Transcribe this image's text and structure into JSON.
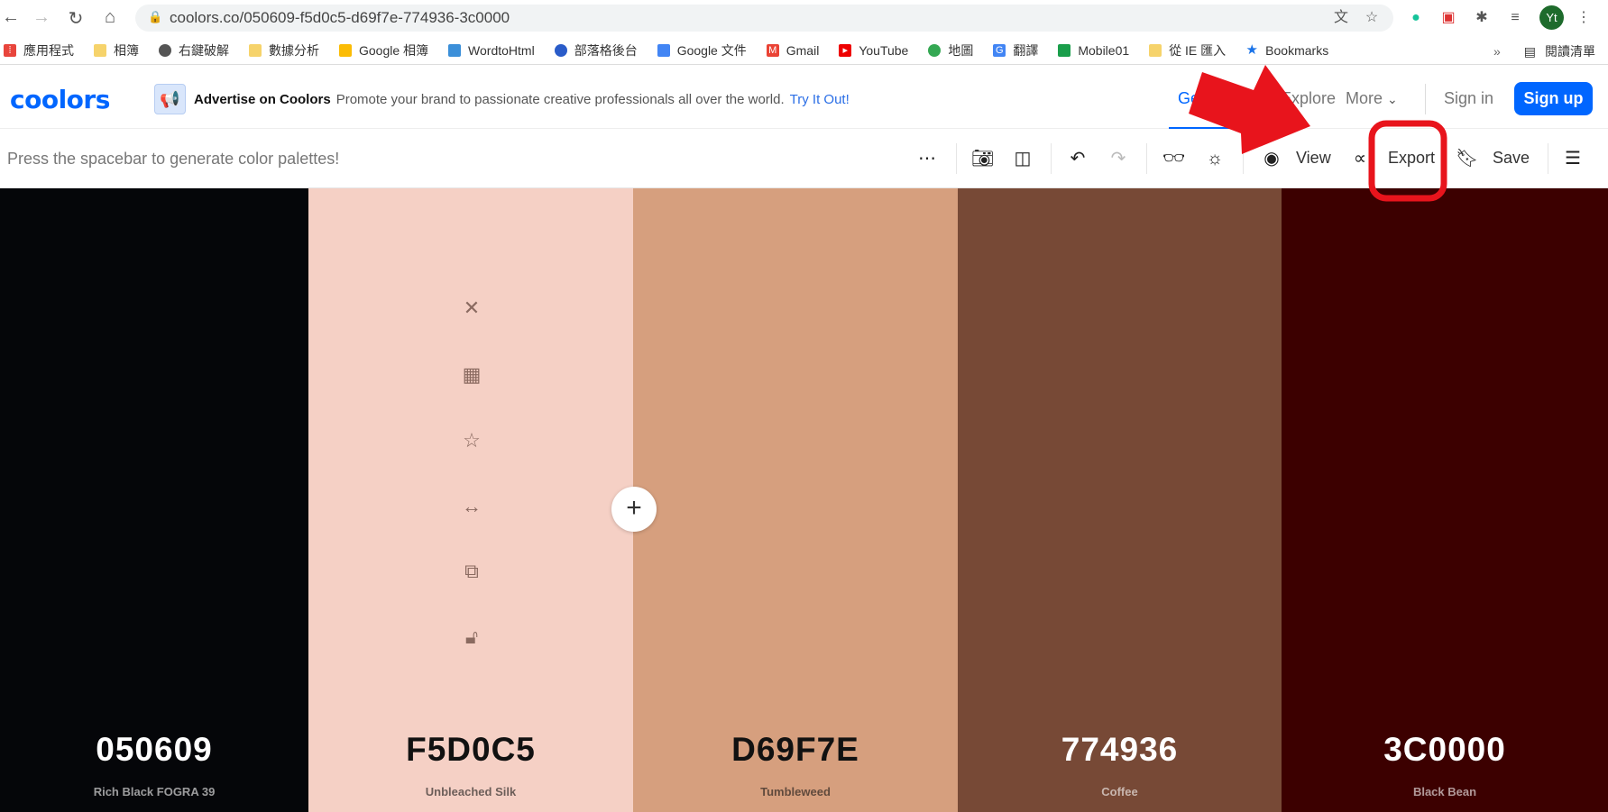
{
  "browser": {
    "url": "coolors.co/050609-f5d0c5-d69f7e-774936-3c0000",
    "avatar": "Yt",
    "bookmarks": [
      "應用程式",
      "相簿",
      "右鍵破解",
      "數據分析",
      "Google 相簿",
      "WordtoHtml",
      "部落格後台",
      "Google 文件",
      "Gmail",
      "YouTube",
      "地圖",
      "翻譯",
      "Mobile01",
      "從 IE 匯入",
      "Bookmarks"
    ],
    "bookmarks_more": "»",
    "reading_list": "閱讀清單"
  },
  "header": {
    "logo": "coolors",
    "ad_title": "Advertise on Coolors",
    "ad_text": "Promote your brand to passionate creative professionals all over the world.",
    "ad_link": "Try It Out!",
    "nav": {
      "generate": "Generate",
      "explore": "Explore",
      "more": "More"
    },
    "sign_in": "Sign in",
    "sign_up": "Sign up"
  },
  "toolbar": {
    "hint": "Press the spacebar to generate color palettes!",
    "view": "View",
    "export": "Export",
    "save": "Save"
  },
  "palette": [
    {
      "hex": "050609",
      "name": "Rich Black FOGRA 39",
      "color": "#050609",
      "text": "#ffffff"
    },
    {
      "hex": "F5D0C5",
      "name": "Unbleached Silk",
      "color": "#F5D0C5",
      "text": "#111111"
    },
    {
      "hex": "D69F7E",
      "name": "Tumbleweed",
      "color": "#D69F7E",
      "text": "#111111"
    },
    {
      "hex": "774936",
      "name": "Coffee",
      "color": "#774936",
      "text": "#ffffff"
    },
    {
      "hex": "3C0000",
      "name": "Black Bean",
      "color": "#3C0000",
      "text": "#ffffff"
    }
  ],
  "colors": {
    "brand": "#0066ff",
    "annotation": "#e8141c"
  }
}
